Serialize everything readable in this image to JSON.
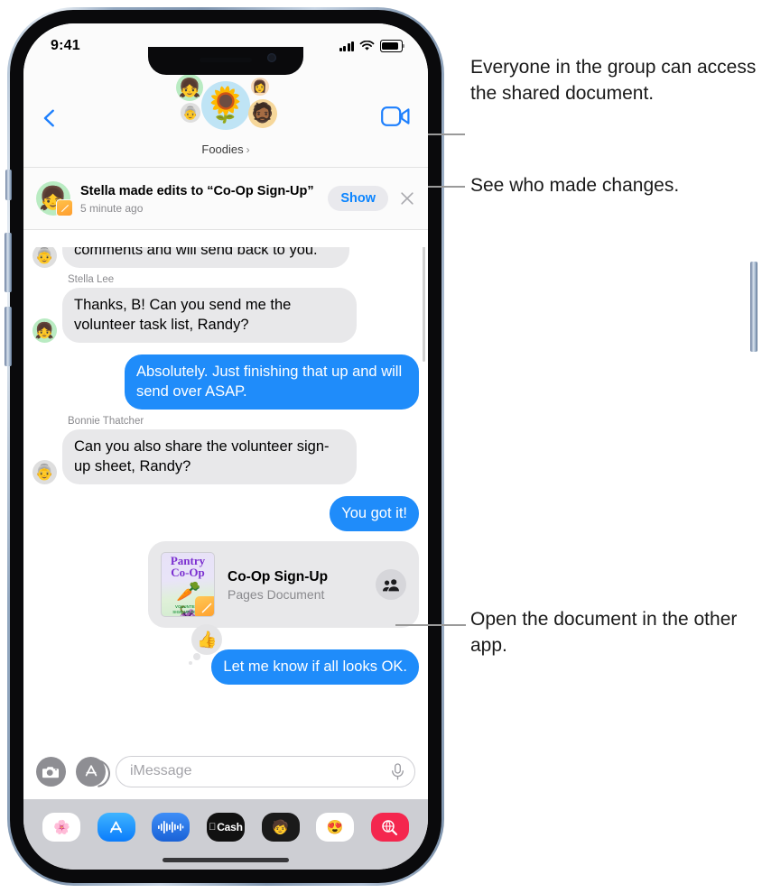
{
  "status_bar": {
    "time": "9:41",
    "signal_icon": "cellular-bars-icon",
    "wifi_icon": "wifi-icon",
    "battery_icon": "battery-icon"
  },
  "nav": {
    "back_icon": "back-chevron-icon",
    "facetime_icon": "video-camera-icon",
    "group_name": "Foodies",
    "group_chevron": "›",
    "avatars": [
      {
        "name": "group-avatar-main",
        "emoji": "🌻",
        "bg": "#bfe4f5"
      },
      {
        "name": "group-avatar-stella",
        "emoji": "👧",
        "bg": "#b9ebc2"
      },
      {
        "name": "group-avatar-bonnie",
        "emoji": "👵",
        "bg": "#dedede"
      },
      {
        "name": "group-avatar-meena",
        "emoji": "👩",
        "bg": "#f7d9b7"
      },
      {
        "name": "group-avatar-randy",
        "emoji": "🧔🏾",
        "bg": "#f6d79a"
      }
    ]
  },
  "banner": {
    "title": "Stella made edits to “Co-Op Sign-Up”",
    "subtitle": "5 minute ago",
    "show_label": "Show",
    "close_icon": "close-x-icon",
    "avatar_emoji": "👧",
    "badge_icon": "pages-app-icon"
  },
  "messages": [
    {
      "id": "msg-meena-clipped",
      "side": "left",
      "sender": "",
      "avatar_emoji": "👵",
      "avatar_bg": "#dedede",
      "text": "Orientation Handbook, Meena. Adding comments and will send back to you.",
      "clipped": true
    },
    {
      "id": "msg-stella-tasklist",
      "side": "left",
      "sender": "Stella Lee",
      "avatar_emoji": "👧",
      "avatar_bg": "#b9ebc2",
      "text": "Thanks, B! Can you send me the volunteer task list, Randy?",
      "clipped": false
    },
    {
      "id": "msg-me-absolutely",
      "side": "right",
      "sender": "",
      "text": "Absolutely. Just finishing that up and will send over ASAP.",
      "clipped": false
    },
    {
      "id": "msg-bonnie-signup",
      "side": "left",
      "sender": "Bonnie Thatcher",
      "avatar_emoji": "👵",
      "avatar_bg": "#dedede",
      "text": "Can you also share the volunteer sign-up sheet, Randy?",
      "clipped": false
    },
    {
      "id": "msg-me-yougotit",
      "side": "right",
      "sender": "",
      "text": "You got it!",
      "clipped": false
    }
  ],
  "attachment": {
    "title": "Co-Op Sign-Up",
    "subtitle": "Pages Document",
    "collab_icon": "people-collaboration-icon",
    "thumb": {
      "line1": "Pantry",
      "line2": "Co-Op",
      "art": "🥕🍇",
      "footer_line1": "VOLUNTEER",
      "footer_line2": "SIGN-UP FORM"
    },
    "badge_icon": "pages-app-icon"
  },
  "last_message": {
    "text": "Let me know if all looks OK.",
    "reaction_icon": "thumbs-up-reaction",
    "reaction_emoji": "👍"
  },
  "input_bar": {
    "camera_icon": "camera-icon",
    "apps_icon": "app-store-icon",
    "placeholder": "iMessage",
    "mic_icon": "microphone-icon"
  },
  "app_drawer": [
    {
      "name": "app-photos",
      "label": "🌸",
      "bg": "#ffffff"
    },
    {
      "name": "app-store",
      "label": "A",
      "bg": "#1f9bfb"
    },
    {
      "name": "app-audio",
      "label": "‖",
      "bg": "#2b7fe8"
    },
    {
      "name": "app-apple-cash",
      "label": "Cash",
      "bg": "#111111"
    },
    {
      "name": "app-memoji",
      "label": "🧒",
      "bg": "#1a1a1a"
    },
    {
      "name": "app-stickers",
      "label": "😍",
      "bg": "#ffffff"
    },
    {
      "name": "app-imageplay",
      "label": "🔍",
      "bg": "#f4274e"
    }
  ],
  "callouts": [
    {
      "id": "callout-shared-doc",
      "text": "Everyone in the group can access the shared document."
    },
    {
      "id": "callout-who-changed",
      "text": "See who made changes."
    },
    {
      "id": "callout-open-doc",
      "text": "Open the document in the other app."
    }
  ],
  "colors": {
    "accent_blue": "#1f8cfa",
    "link_blue": "#0a84ff",
    "bubble_gray": "#e8e8ea",
    "drawer_gray": "#cdced3"
  }
}
